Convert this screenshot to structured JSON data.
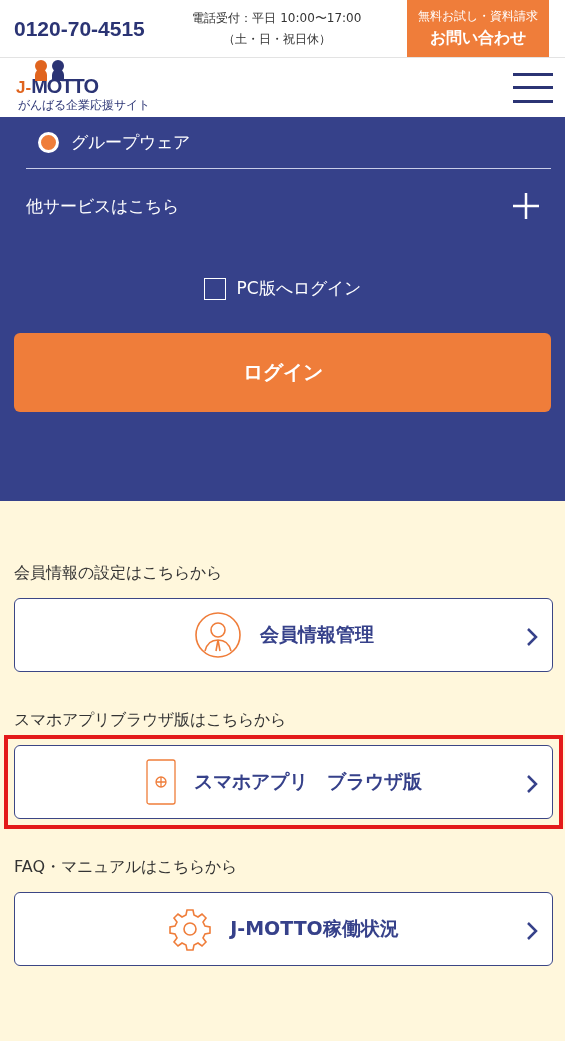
{
  "header": {
    "phone": "0120-70-4515",
    "hours": "電話受付：平日 10:00〜17:00",
    "closed": "（土・日・祝日休）",
    "contact_button": {
      "sub": "無料お試し・資料請求",
      "label": "お問い合わせ"
    }
  },
  "logo": {
    "mark": "J-",
    "name": "MOTTO",
    "tagline": "がんばる企業応援サイト"
  },
  "login_panel": {
    "service": {
      "label": "グループウェア",
      "selected": true
    },
    "other_services": {
      "label": "他サービスはこちら",
      "expanded": false
    },
    "pc_login": {
      "label": "PC版へログイン",
      "checked": false
    },
    "login_button": "ログイン"
  },
  "links": [
    {
      "caption": "会員情報の設定はこちらから",
      "label": "会員情報管理",
      "kind": "member",
      "highlighted": false
    },
    {
      "caption": "スマホアプリブラウザ版はこちらから",
      "label": "スマホアプリ　ブラウザ版",
      "kind": "phone",
      "highlighted": true
    },
    {
      "caption": "FAQ・マニュアルはこちらから",
      "label": "J-MOTTO稼働状況",
      "kind": "status",
      "highlighted": false
    }
  ]
}
